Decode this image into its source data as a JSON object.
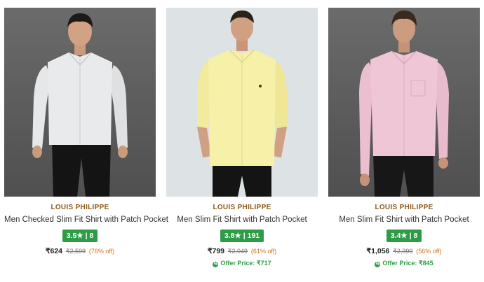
{
  "products": [
    {
      "brand": "LOUIS PHILIPPE",
      "title": "Men Checked Slim Fit Shirt with Patch Pocket",
      "rating": "3.5★ | 8",
      "price": "₹624",
      "mrp": "₹2,599",
      "discount": "(76% off)",
      "offer_price": ""
    },
    {
      "brand": "LOUIS PHILIPPE",
      "title": "Men Slim Fit Shirt with Patch Pocket",
      "rating": "3.8★ | 191",
      "price": "₹799",
      "mrp": "₹2,049",
      "discount": "(61% off)",
      "offer_price": "Offer Price: ₹717"
    },
    {
      "brand": "LOUIS PHILIPPE",
      "title": "Men Slim Fit Shirt with Patch Pocket",
      "rating": "3.4★ | 8",
      "price": "₹1,056",
      "mrp": "₹2,399",
      "discount": "(56% off)",
      "offer_price": "Offer Price: ₹845"
    }
  ],
  "colors": {
    "brand": "#8a5a1c",
    "rating_bg": "#2e9c46",
    "discount": "#c7711e",
    "offer": "#2e9c46",
    "shirt_1": "#e9eaec",
    "shirt_2": "#f6f0a8",
    "shirt_3": "#efc6d6"
  },
  "icons": {
    "offer": "percent-badge-icon"
  }
}
